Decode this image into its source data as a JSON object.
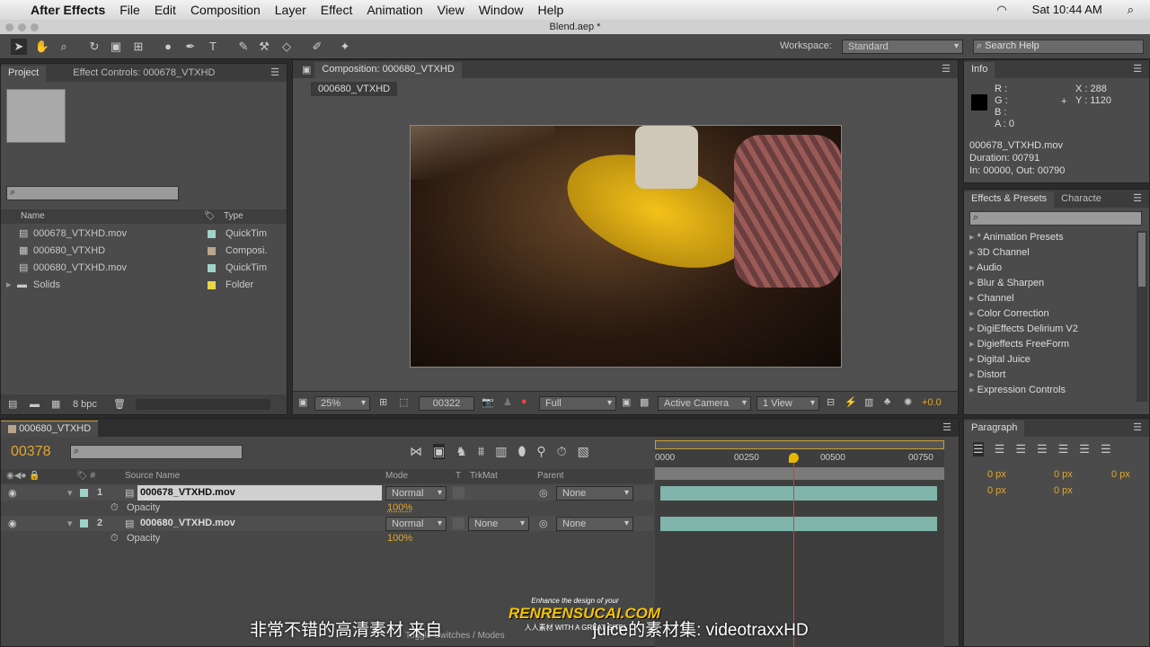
{
  "menubar": {
    "app": "After Effects",
    "items": [
      "File",
      "Edit",
      "Composition",
      "Layer",
      "Effect",
      "Animation",
      "View",
      "Window",
      "Help"
    ],
    "clock": "Sat 10:44 AM"
  },
  "window": {
    "title": "Blend.aep *"
  },
  "toolbar": {
    "workspace_label": "Workspace:",
    "workspace_value": "Standard",
    "search_placeholder": "Search Help"
  },
  "project": {
    "tab_project": "Project",
    "tab_effect_controls": "Effect Controls: 000678_VTXHD",
    "col_name": "Name",
    "col_type": "Type",
    "items": [
      {
        "name": "000678_VTXHD.mov",
        "type": "QuickTim",
        "color": "#9fd3c8"
      },
      {
        "name": "000680_VTXHD",
        "type": "Composi.",
        "color": "#b8a58a"
      },
      {
        "name": "000680_VTXHD.mov",
        "type": "QuickTim",
        "color": "#9fd3c8"
      },
      {
        "name": "Solids",
        "type": "Folder",
        "color": "#e6d84a"
      }
    ],
    "bpc": "8 bpc"
  },
  "composition": {
    "tab": "Composition: 000680_VTXHD",
    "breadcrumb": "000680_VTXHD",
    "zoom": "25%",
    "timecode": "00322",
    "resolution": "Full",
    "camera": "Active Camera",
    "views": "1 View",
    "exposure": "+0.0"
  },
  "info": {
    "tab": "Info",
    "r": "R :",
    "g": "G :",
    "b": "B :",
    "a": "A : 0",
    "x": "X : 288",
    "y": "Y : 1120",
    "file": "000678_VTXHD.mov",
    "duration": "Duration: 00791",
    "inout": "In: 00000, Out: 00790"
  },
  "effects": {
    "tab": "Effects & Presets",
    "tab2": "Characte",
    "items": [
      "* Animation Presets",
      "3D Channel",
      "Audio",
      "Blur & Sharpen",
      "Channel",
      "Color Correction",
      "DigiEffects Delirium V2",
      "Digieffects FreeForm",
      "Digital Juice",
      "Distort",
      "Expression Controls"
    ]
  },
  "timeline": {
    "tab": "000680_VTXHD",
    "current_time": "00378",
    "headers": {
      "source": "Source Name",
      "mode": "Mode",
      "t": "T",
      "trkmat": "TrkMat",
      "parent": "Parent"
    },
    "layers": [
      {
        "num": "1",
        "name": "000678_VTXHD.mov",
        "mode": "Normal",
        "trkmat": "",
        "parent": "None",
        "prop": "Opacity",
        "value": "100%"
      },
      {
        "num": "2",
        "name": "000680_VTXHD.mov",
        "mode": "Normal",
        "trkmat": "None",
        "parent": "None",
        "prop": "Opacity",
        "value": "100%"
      }
    ],
    "ruler": [
      "0000",
      "00250",
      "00500",
      "00750"
    ],
    "playhead_fraction": 0.478,
    "footer": "Toggle Switches / Modes"
  },
  "paragraph": {
    "tab": "Paragraph",
    "values": [
      "0 px",
      "0 px",
      "0 px",
      "0 px",
      "0 px"
    ]
  },
  "subtitle": {
    "left": "非常不错的高清素材 来自",
    "right": "juice的素材集: videotraxxHD"
  },
  "watermark": {
    "top": "Enhance the design of your",
    "main": "RENRENSUCAI.COM",
    "bottom": "人人素材 WITH A GREAT SITE!"
  }
}
